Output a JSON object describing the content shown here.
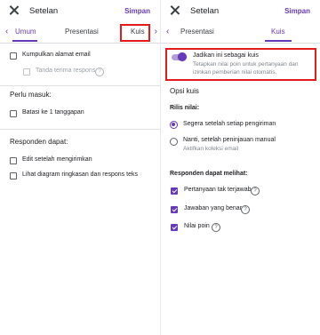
{
  "header": {
    "title": "Setelan",
    "save_label": "Simpan"
  },
  "left": {
    "tabs": {
      "general_partial": "Umum",
      "presentation": "Presentasi",
      "quiz": "Kuis"
    },
    "collect_email": "Kumpulkan alamat email",
    "receipt": "Tanda terima respons",
    "requires_heading": "Perlu masuk:",
    "limit_one": "Batasi ke 1 tanggapan",
    "respondents_heading": "Responden dapat:",
    "edit_after": "Edit setelah mengirimkan",
    "see_summary": "Lihat diagram ringkasan dan respons teks"
  },
  "right": {
    "tabs": {
      "presentation": "Presentasi",
      "quiz": "Kuis"
    },
    "make_quiz": {
      "label": "Jadikan ini sebagai kuis",
      "desc_line1": "Tetapkan nilai poin untuk pertanyaan dan",
      "desc_line2": "izinkan pemberian nilai otomatis."
    },
    "quiz_options_heading": "Opsi kuis",
    "release_grade_heading": "Rilis nilai:",
    "immediately": "Segera setelah setiap pengiriman",
    "later_line1": "Nanti, setelah peninjauan manual",
    "later_line2": "Aktifkan koleksi email",
    "can_see_heading": "Responden dapat melihat:",
    "missed": "Pertanyaan tak terjawab",
    "correct": "Jawaban yang benar",
    "points": "Nilai poin"
  },
  "colors": {
    "accent": "#673ab7",
    "highlight": "#e21b1b"
  },
  "icons": [
    "close-icon",
    "chevron-left-icon",
    "chevron-right-icon",
    "help-icon"
  ]
}
